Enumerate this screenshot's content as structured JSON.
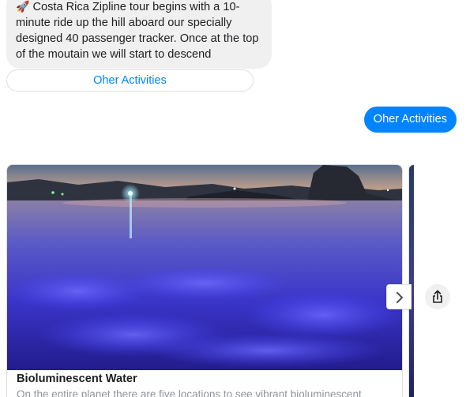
{
  "bot_message": {
    "emoji": "🚀",
    "text": "Costa Rica Zipline tour begins with a 10-minute ride up the hill aboard our specially designed 40 passenger tracker. Once at the top of the moutain we will start to descend"
  },
  "quick_reply": {
    "label": "Oher Activities"
  },
  "user_message": {
    "text": "Oher Activities"
  },
  "carousel": {
    "cards": [
      {
        "image": "bioluminescent-water-photo",
        "title": "Bioluminescent Water",
        "subtitle": "On the entire planet there are five locations to see vibrant bioluminescent"
      }
    ],
    "next_icon": "chevron-right-icon",
    "share_icon": "share-icon"
  },
  "colors": {
    "messenger_blue": "#0084ff",
    "bubble_gray": "#f1f0f0",
    "border_gray": "#dddfe2"
  }
}
